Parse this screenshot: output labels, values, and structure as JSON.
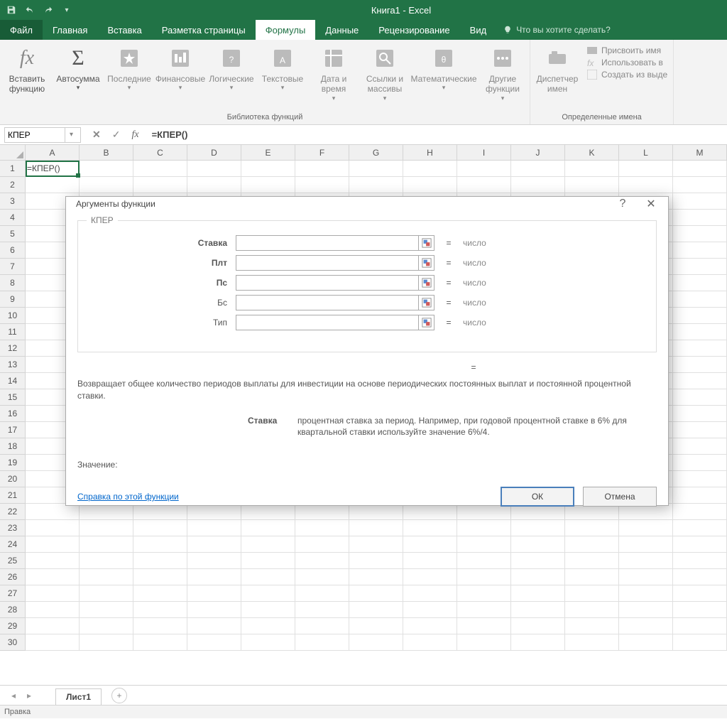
{
  "app_title": "Книга1 - Excel",
  "qat": {
    "save": "save-icon",
    "undo": "undo-icon",
    "redo": "redo-icon"
  },
  "tabs": {
    "file": "Файл",
    "home": "Главная",
    "insert": "Вставка",
    "pagelayout": "Разметка страницы",
    "formulas": "Формулы",
    "data": "Данные",
    "review": "Рецензирование",
    "view": "Вид"
  },
  "tell_me": "Что вы хотите сделать?",
  "ribbon": {
    "insert_function": "Вставить\nфункцию",
    "autosum": "Автосумма",
    "recent": "Последние",
    "financial": "Финансовые",
    "logical": "Логические",
    "text": "Текстовые",
    "datetime": "Дата и\nвремя",
    "lookup": "Ссылки и\nмассивы",
    "math": "Математические",
    "more": "Другие\nфункции",
    "name_mgr": "Диспетчер\nимен",
    "define_name": "Присвоить имя",
    "use_in_formula": "Использовать в",
    "create_from_sel": "Создать из выде",
    "group_lib": "Библиотека функций",
    "group_names": "Определенные имена"
  },
  "namebox": "КПЕР",
  "formula": "=КПЕР()",
  "columns": [
    "A",
    "B",
    "C",
    "D",
    "E",
    "F",
    "G",
    "H",
    "I",
    "J",
    "K",
    "L",
    "M"
  ],
  "rows": [
    "1",
    "2",
    "3",
    "4",
    "5",
    "6",
    "7",
    "8",
    "9",
    "10",
    "11",
    "12",
    "13",
    "14",
    "15",
    "16",
    "17",
    "18",
    "19",
    "20",
    "21",
    "22",
    "23",
    "24",
    "25",
    "26",
    "27",
    "28",
    "29",
    "30"
  ],
  "cell_a1": "=КПЕР()",
  "sheet_tab": "Лист1",
  "status": "Правка",
  "dialog": {
    "title": "Аргументы функции",
    "legend": "КПЕР",
    "args": [
      {
        "label": "Ставка",
        "bold": true,
        "value": "",
        "result": "число"
      },
      {
        "label": "Плт",
        "bold": true,
        "value": "",
        "result": "число"
      },
      {
        "label": "Пс",
        "bold": true,
        "value": "",
        "result": "число"
      },
      {
        "label": "Бс",
        "bold": false,
        "value": "",
        "result": "число"
      },
      {
        "label": "Тип",
        "bold": false,
        "value": "",
        "result": "число"
      }
    ],
    "equals": "=",
    "desc": "Возвращает общее количество периодов выплаты для инвестиции на основе периодических постоянных выплат и постоянной процентной ставки.",
    "arg_name": "Ставка",
    "arg_desc": "процентная ставка за период. Например, при годовой процентной ставке в 6% для квартальной ставки используйте значение 6%/4.",
    "value_label": "Значение:",
    "help_link": "Справка по этой функции",
    "ok": "ОК",
    "cancel": "Отмена"
  }
}
